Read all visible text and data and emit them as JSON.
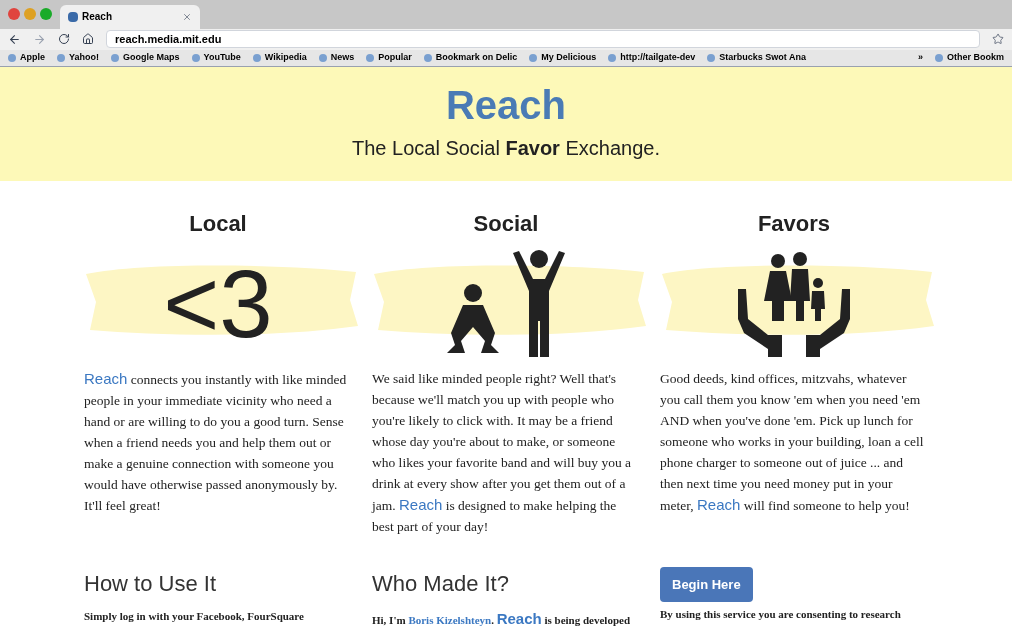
{
  "browser": {
    "tab_label": "Reach",
    "url": "reach.media.mit.edu",
    "bookmarks": [
      "Apple",
      "Yahoo!",
      "Google Maps",
      "YouTube",
      "Wikipedia",
      "News",
      "Popular",
      "Bookmark on Delic",
      "My Delicious",
      "http://tailgate-dev",
      "Starbucks Swot Ana"
    ],
    "overflow": "»",
    "other_bookmarks": "Other Bookm"
  },
  "header": {
    "title": "Reach",
    "tagline": "The Local Social **Favor** Exchange."
  },
  "features": [
    {
      "heading": "Local",
      "kind": "text",
      "art": "<3",
      "text": [
        {
          "kind": "link",
          "s": "Reach"
        },
        {
          "kind": "plain",
          "s": " connects you instantly with like minded people in your immediate vicinity who need a hand or are willing to do you a good turn. Sense when a friend needs you and help them out or make a genuine connection with someone you would have otherwise passed anonymously by. It'll feel great!"
        }
      ]
    },
    {
      "heading": "Social",
      "kind": "people",
      "text": [
        {
          "kind": "plain",
          "s": "We said like minded people right? Well that's because we'll match you up with people who you're likely to click with. It may be a friend whose day you're about to make, or someone who likes your favorite band and will buy you a drink at every show after you get them out of a jam. "
        },
        {
          "kind": "link",
          "s": "Reach"
        },
        {
          "kind": "plain",
          "s": " is designed to make helping the best part of your day!"
        }
      ]
    },
    {
      "heading": "Favors",
      "kind": "hands",
      "text": [
        {
          "kind": "plain",
          "s": "Good deeds, kind offices, mitzvahs, whatever you call them you know 'em when you need 'em AND when you've done 'em. Pick up lunch for someone who works in your building, loan a cell phone charger to someone out of juice ... and then next time you need money put in your meter, "
        },
        {
          "kind": "link",
          "s": "Reach"
        },
        {
          "kind": "plain",
          "s": " will find someone to help you!"
        }
      ]
    }
  ],
  "how_to": {
    "heading": "How to Use It",
    "text": "Simply log in with your Facebook, FourSquare"
  },
  "who": {
    "heading": "Who Made It?",
    "text": [
      {
        "kind": "plain",
        "s": "Hi, I'm "
      },
      {
        "kind": "name",
        "s": "Boris Kizelshteyn"
      },
      {
        "kind": "plain",
        "s": ". "
      },
      {
        "kind": "link",
        "s": "Reach"
      },
      {
        "kind": "plain",
        "s": " is being developed"
      }
    ]
  },
  "begin": {
    "button": "Begin Here",
    "text": "By using this service you are consenting to research"
  }
}
